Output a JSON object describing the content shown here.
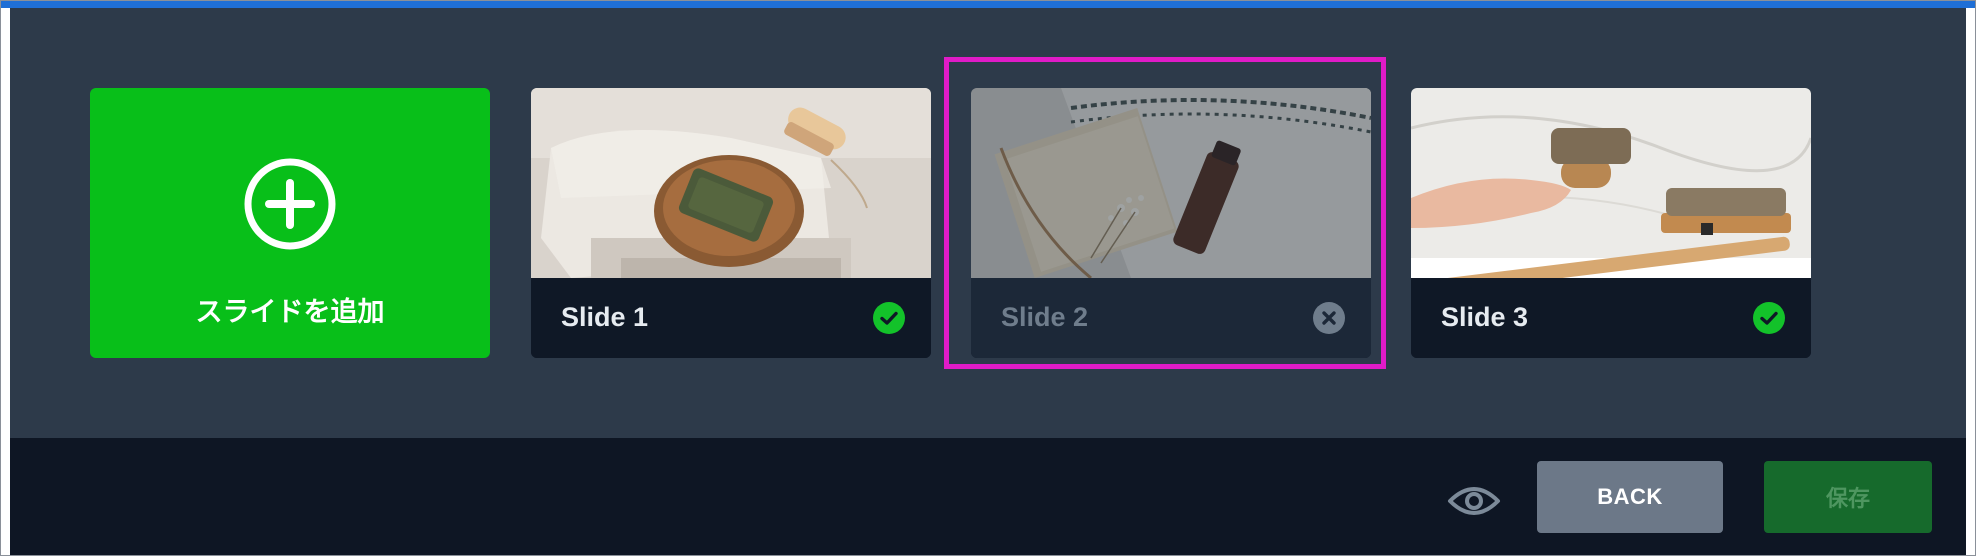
{
  "add_tile": {
    "label": "スライドを追加",
    "icon": "plus-circle-icon"
  },
  "slides": [
    {
      "name": "Slide 1",
      "status": "complete",
      "status_icon": "check-circle-icon",
      "thumbnail": "soap bar on wooden dish with towel and brush"
    },
    {
      "name": "Slide 2",
      "status": "error",
      "status_icon": "close-circle-icon",
      "thumbnail": "amber bottle with dried flowers and book",
      "selected": true
    },
    {
      "name": "Slide 3",
      "status": "complete",
      "status_icon": "check-circle-icon",
      "thumbnail": "hand holding bristle brush over marble"
    }
  ],
  "footer": {
    "preview_icon": "eye-icon",
    "back_label": "BACK",
    "save_label": "保存"
  },
  "colors": {
    "panel_bg": "#2d3a4a",
    "footer_bg": "#0e1624",
    "add_green": "#08bf19",
    "check_green": "#13c22a",
    "selection": "#e01bc7",
    "top_accent": "#1f6fd6"
  }
}
